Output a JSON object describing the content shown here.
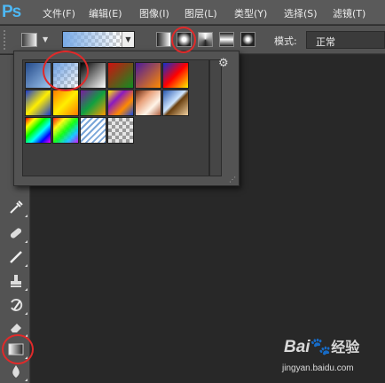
{
  "app": {
    "logo": "Ps"
  },
  "menu": [
    {
      "id": "file",
      "label": "文件(F)"
    },
    {
      "id": "edit",
      "label": "编辑(E)"
    },
    {
      "id": "image",
      "label": "图像(I)"
    },
    {
      "id": "layer",
      "label": "图层(L)"
    },
    {
      "id": "type",
      "label": "类型(Y)"
    },
    {
      "id": "select",
      "label": "选择(S)"
    },
    {
      "id": "filter",
      "label": "滤镜(T)"
    }
  ],
  "options": {
    "mode_label": "模式:",
    "mode_value": "正常",
    "gradient_types": [
      "linear",
      "radial",
      "angle",
      "reflected",
      "diamond"
    ],
    "selected_type": "radial"
  },
  "picker": {
    "gear_icon": "⚙",
    "selected_index": 1,
    "presets": [
      {
        "name": "foreground-to-background"
      },
      {
        "name": "foreground-to-transparent"
      },
      {
        "name": "black-white"
      },
      {
        "name": "red-green"
      },
      {
        "name": "violet-orange"
      },
      {
        "name": "blue-red-yellow"
      },
      {
        "name": "blue-yellow-blue"
      },
      {
        "name": "orange-yellow-orange"
      },
      {
        "name": "violet-green-orange"
      },
      {
        "name": "yellow-violet-orange-blue"
      },
      {
        "name": "copper"
      },
      {
        "name": "chrome"
      },
      {
        "name": "spectrum"
      },
      {
        "name": "transparent-rainbow"
      },
      {
        "name": "transparent-stripes"
      },
      {
        "name": "neutral-density"
      }
    ]
  },
  "toolbar": {
    "tools": [
      "eyedropper",
      "healing-brush",
      "brush",
      "clone-stamp",
      "history-brush",
      "eraser",
      "gradient",
      "blur"
    ],
    "active": "gradient"
  },
  "watermark": {
    "brand": "Bai",
    "brand2": "经验",
    "url": "jingyan.baidu.com"
  },
  "colors": {
    "highlight_ring": "#e02a2a",
    "menubar": "#5a5a5a",
    "panel": "#535353"
  }
}
